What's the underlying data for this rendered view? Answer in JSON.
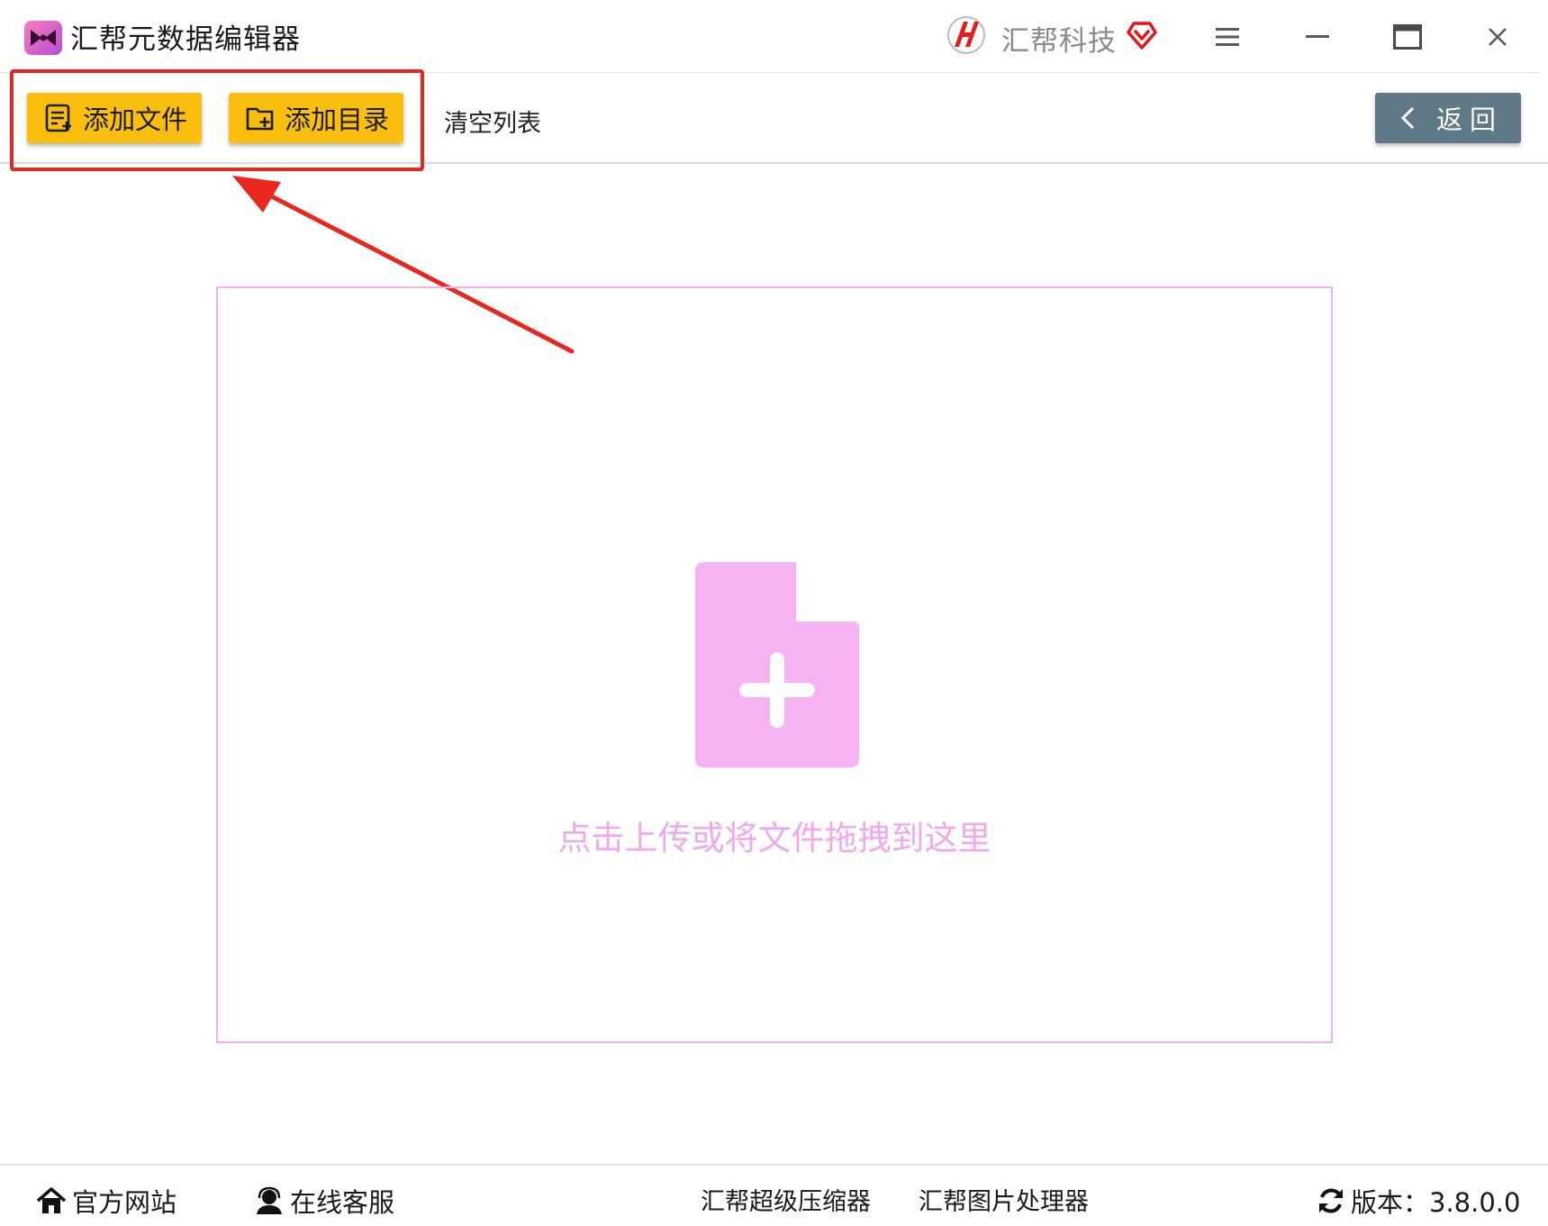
{
  "app": {
    "title": "汇帮元数据编辑器",
    "logo_icon": "bow-tie-logo-icon",
    "brand_name": "汇帮科技",
    "brand_icon": "huibang-h-logo-icon",
    "vip_icon": "heart-vip-icon"
  },
  "window_controls": {
    "menu_icon": "hamburger-menu-icon",
    "minimize_icon": "minimize-icon",
    "maximize_icon": "maximize-icon",
    "close_icon": "close-icon"
  },
  "toolbar": {
    "add_file_label": "添加文件",
    "add_dir_label": "添加目录",
    "clear_list_label": "清空列表",
    "back_label": "返回"
  },
  "dropzone": {
    "hint": "点击上传或将文件拖拽到这里",
    "icon": "file-plus-icon"
  },
  "footer": {
    "official_site": "官方网站",
    "online_service": "在线客服",
    "compressor_link": "汇帮超级压缩器",
    "image_tool_link": "汇帮图片处理器",
    "version_label": "版本：3.8.0.0"
  },
  "colors": {
    "primary_button": "#f9be0e",
    "back_button": "#5f7a86",
    "dropzone_accent": "#f6b3f4",
    "highlight": "#e8271f"
  }
}
